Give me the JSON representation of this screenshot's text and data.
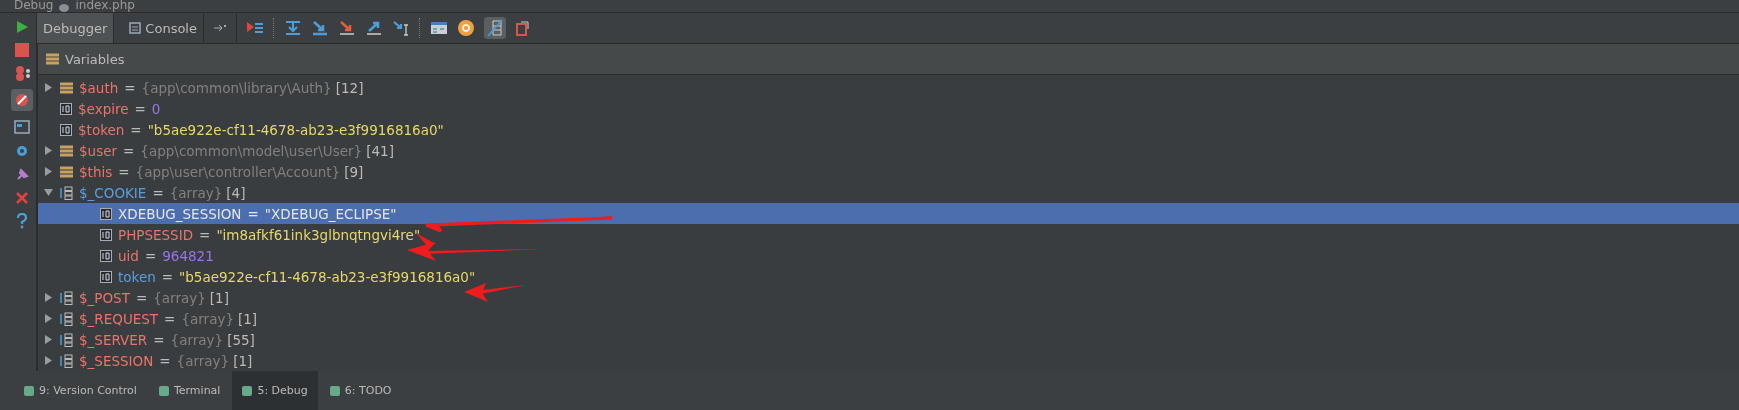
{
  "window": {
    "title": "Debug",
    "file": "index.php"
  },
  "tabs": [
    {
      "label": "Debugger",
      "selected": true
    },
    {
      "label": "Console",
      "selected": false
    }
  ],
  "panel": {
    "title": "Variables"
  },
  "variables": [
    {
      "name": "$auth",
      "operator": "=",
      "kind": "object",
      "type": "{app\\common\\library\\Auth}",
      "count": "[12]",
      "expanded": false,
      "modified": false,
      "selected": false
    },
    {
      "name": "$expire",
      "operator": "=",
      "kind": "int",
      "value": "0",
      "modified": false,
      "selected": false
    },
    {
      "name": "$token",
      "operator": "=",
      "kind": "string",
      "value": "\"b5ae922e-cf11-4678-ab23-e3f9916816a0\"",
      "modified": false,
      "selected": false
    },
    {
      "name": "$user",
      "operator": "=",
      "kind": "object",
      "type": "{app\\common\\model\\user\\User}",
      "count": "[41]",
      "expanded": false,
      "modified": false,
      "selected": false
    },
    {
      "name": "$this",
      "operator": "=",
      "kind": "object",
      "type": "{app\\user\\controller\\Account}",
      "count": "[9]",
      "expanded": false,
      "modified": false,
      "selected": false
    },
    {
      "name": "$_COOKIE",
      "operator": "=",
      "kind": "array",
      "type": "{array}",
      "count": "[4]",
      "expanded": true,
      "modified": true,
      "selected": false,
      "children": [
        {
          "name": "XDEBUG_SESSION",
          "operator": "=",
          "kind": "string",
          "value": "\"XDEBUG_ECLIPSE\"",
          "modified": false,
          "selected": true
        },
        {
          "name": "PHPSESSID",
          "operator": "=",
          "kind": "string",
          "value": "\"im8afkf61ink3glbnqtngvi4re\"",
          "modified": false,
          "selected": false
        },
        {
          "name": "uid",
          "operator": "=",
          "kind": "int",
          "value": "964821",
          "modified": false,
          "selected": false
        },
        {
          "name": "token",
          "operator": "=",
          "kind": "string",
          "value": "\"b5ae922e-cf11-4678-ab23-e3f9916816a0\"",
          "modified": true,
          "selected": false
        }
      ]
    },
    {
      "name": "$_POST",
      "operator": "=",
      "kind": "array",
      "type": "{array}",
      "count": "[1]",
      "expanded": false,
      "modified": false,
      "selected": false
    },
    {
      "name": "$_REQUEST",
      "operator": "=",
      "kind": "array",
      "type": "{array}",
      "count": "[1]",
      "expanded": false,
      "modified": false,
      "selected": false
    },
    {
      "name": "$_SERVER",
      "operator": "=",
      "kind": "array",
      "type": "{array}",
      "count": "[55]",
      "expanded": false,
      "modified": false,
      "selected": false
    },
    {
      "name": "$_SESSION",
      "operator": "=",
      "kind": "array",
      "type": "{array}",
      "count": "[1]",
      "expanded": false,
      "modified": false,
      "selected": false
    }
  ],
  "bottom_tabs": [
    {
      "label": "9: Version Control",
      "selected": false
    },
    {
      "label": "Terminal",
      "selected": false
    },
    {
      "label": "5: Debug",
      "selected": true
    },
    {
      "label": "6: TODO",
      "selected": false
    }
  ]
}
